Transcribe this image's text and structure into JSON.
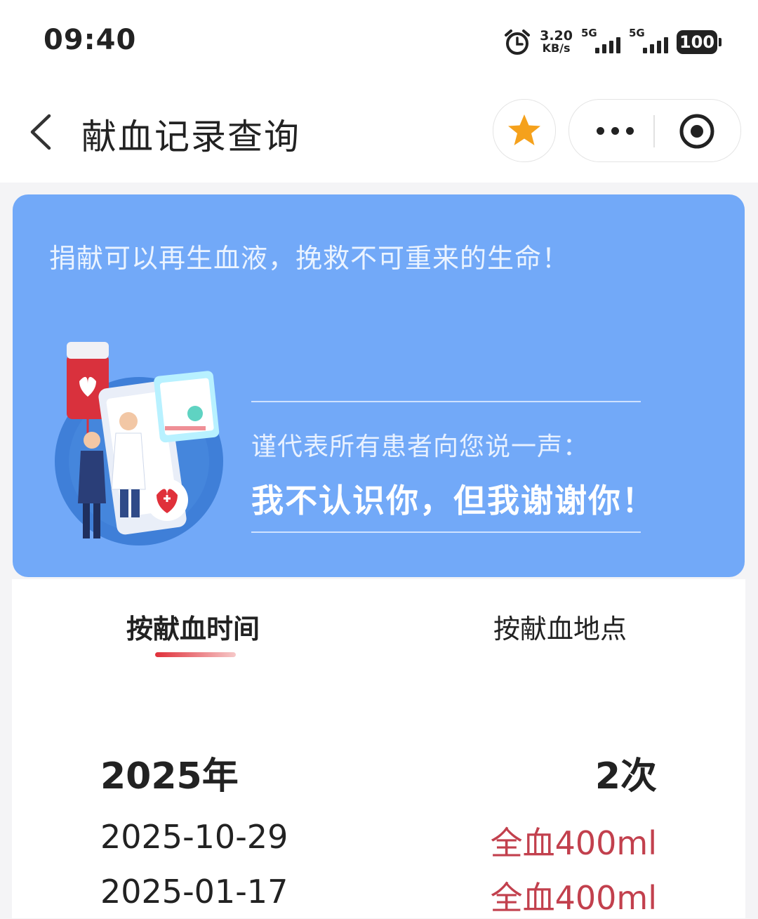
{
  "status_bar": {
    "time": "09:40",
    "net_speed_value": "3.20",
    "net_speed_unit": "KB/s",
    "sim1_type": "5G",
    "sim2_type": "5G",
    "battery": "100",
    "icons": [
      "alarm-icon",
      "signal-icon",
      "signal-icon",
      "battery-icon"
    ]
  },
  "nav": {
    "title": "献血记录查询",
    "icons": [
      "back-arrow-icon",
      "star-icon",
      "more-dots-icon",
      "close-target-icon"
    ],
    "star_color": "#f5a11c"
  },
  "banner": {
    "slogan": "捐献可以再生血液，挽救不可重来的生命！",
    "sub_text": "谨代表所有患者向您说一声：",
    "thanks_text": "我不认识你，但我谢谢你！",
    "background_color": "#72a9f8"
  },
  "tabs": [
    {
      "label": "按献血时间",
      "active": true
    },
    {
      "label": "按献血地点",
      "active": false
    }
  ],
  "tab_indicator_color": "#e0303a",
  "records": {
    "year": "2025年",
    "count": "2次",
    "items": [
      {
        "date": "2025-10-29",
        "amount": "全血400ml"
      },
      {
        "date": "2025-01-17",
        "amount": "全血400ml"
      }
    ],
    "amount_color": "#c2404d"
  }
}
